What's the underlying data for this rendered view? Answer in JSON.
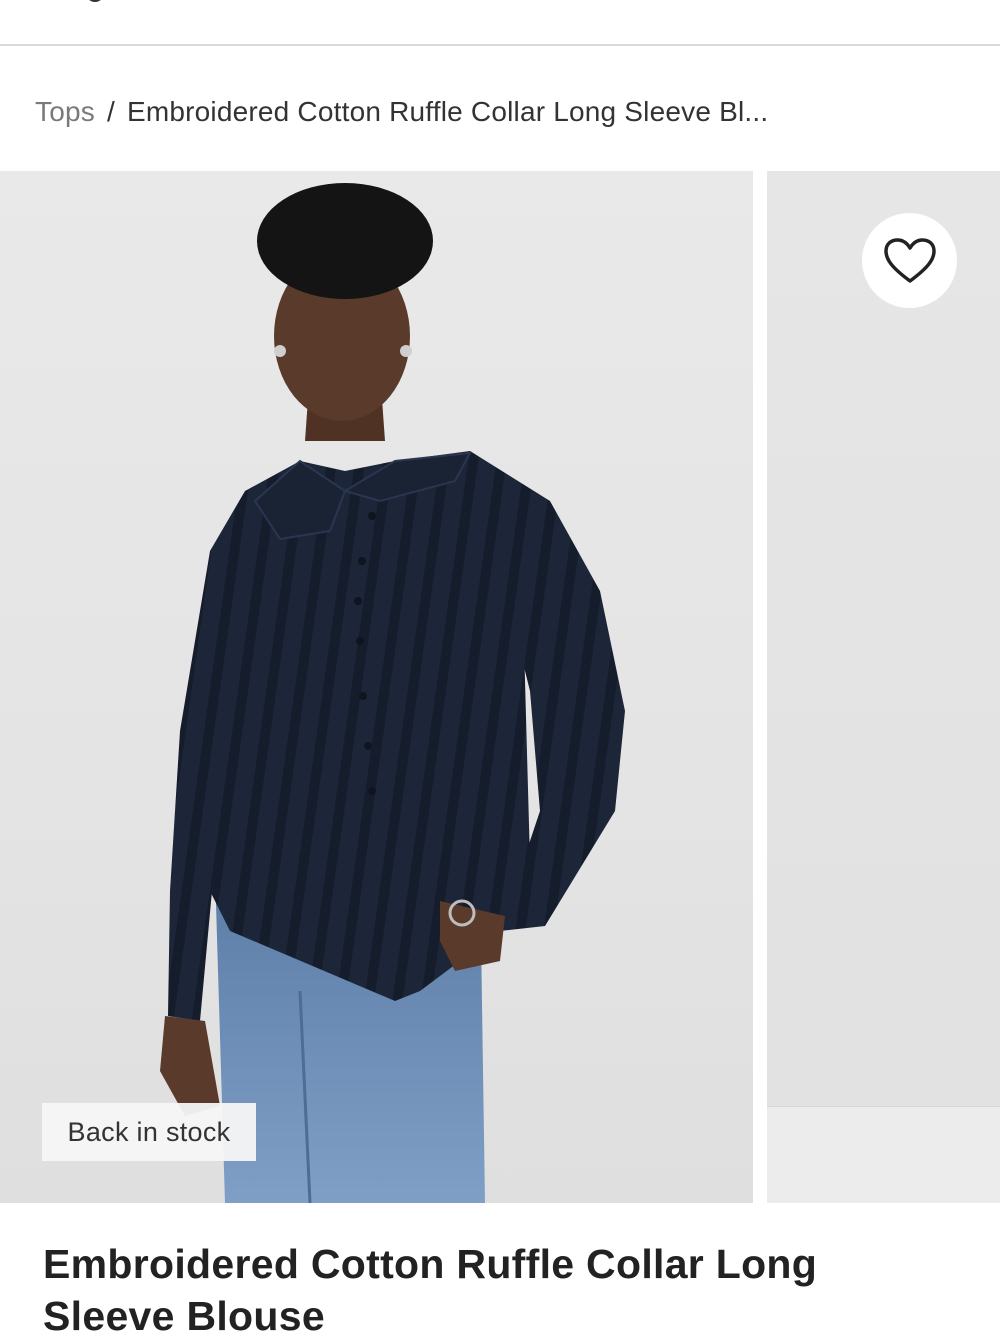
{
  "breadcrumb": {
    "parent": "Tops",
    "separator": "/",
    "current": "Embroidered Cotton Ruffle Collar Long Sleeve Bl..."
  },
  "gallery": {
    "badge": "Back in stock",
    "wishlist_icon": "heart-outline-icon",
    "image_alt": "Model wearing navy embroidered cotton ruffle collar long sleeve blouse with blue jeans"
  },
  "product": {
    "title": "Embroidered Cotton Ruffle Collar Long Sleeve Blouse"
  },
  "colors": {
    "blouse": "#1c2638",
    "denim": "#6e8fb8",
    "skin": "#5a3a2a",
    "background": "#e6e6e6"
  }
}
